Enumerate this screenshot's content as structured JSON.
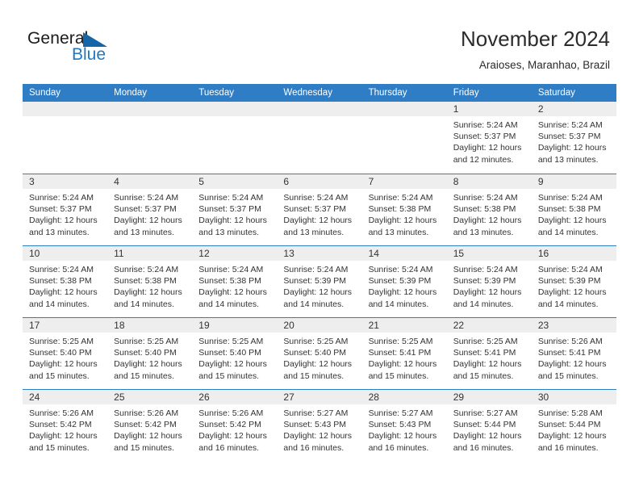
{
  "brand": {
    "name_top": "General",
    "name_bottom": "Blue",
    "triangle_icon": "triangle-icon",
    "color_dark": "#1b1b1b",
    "color_blue": "#1f78c1"
  },
  "header": {
    "title": "November 2024",
    "subtitle": "Araioses, Maranhao, Brazil"
  },
  "theme": {
    "header_blue": "#2f7dc4",
    "day_band_gray": "#eeeeee",
    "text": "#333333"
  },
  "calendar": {
    "weekdays": [
      "Sunday",
      "Monday",
      "Tuesday",
      "Wednesday",
      "Thursday",
      "Friday",
      "Saturday"
    ],
    "weeks": [
      [
        {
          "day": "",
          "lines": []
        },
        {
          "day": "",
          "lines": []
        },
        {
          "day": "",
          "lines": []
        },
        {
          "day": "",
          "lines": []
        },
        {
          "day": "",
          "lines": []
        },
        {
          "day": "1",
          "lines": [
            "Sunrise: 5:24 AM",
            "Sunset: 5:37 PM",
            "Daylight: 12 hours",
            "and 12 minutes."
          ]
        },
        {
          "day": "2",
          "lines": [
            "Sunrise: 5:24 AM",
            "Sunset: 5:37 PM",
            "Daylight: 12 hours",
            "and 13 minutes."
          ]
        }
      ],
      [
        {
          "day": "3",
          "lines": [
            "Sunrise: 5:24 AM",
            "Sunset: 5:37 PM",
            "Daylight: 12 hours",
            "and 13 minutes."
          ]
        },
        {
          "day": "4",
          "lines": [
            "Sunrise: 5:24 AM",
            "Sunset: 5:37 PM",
            "Daylight: 12 hours",
            "and 13 minutes."
          ]
        },
        {
          "day": "5",
          "lines": [
            "Sunrise: 5:24 AM",
            "Sunset: 5:37 PM",
            "Daylight: 12 hours",
            "and 13 minutes."
          ]
        },
        {
          "day": "6",
          "lines": [
            "Sunrise: 5:24 AM",
            "Sunset: 5:37 PM",
            "Daylight: 12 hours",
            "and 13 minutes."
          ]
        },
        {
          "day": "7",
          "lines": [
            "Sunrise: 5:24 AM",
            "Sunset: 5:38 PM",
            "Daylight: 12 hours",
            "and 13 minutes."
          ]
        },
        {
          "day": "8",
          "lines": [
            "Sunrise: 5:24 AM",
            "Sunset: 5:38 PM",
            "Daylight: 12 hours",
            "and 13 minutes."
          ]
        },
        {
          "day": "9",
          "lines": [
            "Sunrise: 5:24 AM",
            "Sunset: 5:38 PM",
            "Daylight: 12 hours",
            "and 14 minutes."
          ]
        }
      ],
      [
        {
          "day": "10",
          "lines": [
            "Sunrise: 5:24 AM",
            "Sunset: 5:38 PM",
            "Daylight: 12 hours",
            "and 14 minutes."
          ]
        },
        {
          "day": "11",
          "lines": [
            "Sunrise: 5:24 AM",
            "Sunset: 5:38 PM",
            "Daylight: 12 hours",
            "and 14 minutes."
          ]
        },
        {
          "day": "12",
          "lines": [
            "Sunrise: 5:24 AM",
            "Sunset: 5:38 PM",
            "Daylight: 12 hours",
            "and 14 minutes."
          ]
        },
        {
          "day": "13",
          "lines": [
            "Sunrise: 5:24 AM",
            "Sunset: 5:39 PM",
            "Daylight: 12 hours",
            "and 14 minutes."
          ]
        },
        {
          "day": "14",
          "lines": [
            "Sunrise: 5:24 AM",
            "Sunset: 5:39 PM",
            "Daylight: 12 hours",
            "and 14 minutes."
          ]
        },
        {
          "day": "15",
          "lines": [
            "Sunrise: 5:24 AM",
            "Sunset: 5:39 PM",
            "Daylight: 12 hours",
            "and 14 minutes."
          ]
        },
        {
          "day": "16",
          "lines": [
            "Sunrise: 5:24 AM",
            "Sunset: 5:39 PM",
            "Daylight: 12 hours",
            "and 14 minutes."
          ]
        }
      ],
      [
        {
          "day": "17",
          "lines": [
            "Sunrise: 5:25 AM",
            "Sunset: 5:40 PM",
            "Daylight: 12 hours",
            "and 15 minutes."
          ]
        },
        {
          "day": "18",
          "lines": [
            "Sunrise: 5:25 AM",
            "Sunset: 5:40 PM",
            "Daylight: 12 hours",
            "and 15 minutes."
          ]
        },
        {
          "day": "19",
          "lines": [
            "Sunrise: 5:25 AM",
            "Sunset: 5:40 PM",
            "Daylight: 12 hours",
            "and 15 minutes."
          ]
        },
        {
          "day": "20",
          "lines": [
            "Sunrise: 5:25 AM",
            "Sunset: 5:40 PM",
            "Daylight: 12 hours",
            "and 15 minutes."
          ]
        },
        {
          "day": "21",
          "lines": [
            "Sunrise: 5:25 AM",
            "Sunset: 5:41 PM",
            "Daylight: 12 hours",
            "and 15 minutes."
          ]
        },
        {
          "day": "22",
          "lines": [
            "Sunrise: 5:25 AM",
            "Sunset: 5:41 PM",
            "Daylight: 12 hours",
            "and 15 minutes."
          ]
        },
        {
          "day": "23",
          "lines": [
            "Sunrise: 5:26 AM",
            "Sunset: 5:41 PM",
            "Daylight: 12 hours",
            "and 15 minutes."
          ]
        }
      ],
      [
        {
          "day": "24",
          "lines": [
            "Sunrise: 5:26 AM",
            "Sunset: 5:42 PM",
            "Daylight: 12 hours",
            "and 15 minutes."
          ]
        },
        {
          "day": "25",
          "lines": [
            "Sunrise: 5:26 AM",
            "Sunset: 5:42 PM",
            "Daylight: 12 hours",
            "and 15 minutes."
          ]
        },
        {
          "day": "26",
          "lines": [
            "Sunrise: 5:26 AM",
            "Sunset: 5:42 PM",
            "Daylight: 12 hours",
            "and 16 minutes."
          ]
        },
        {
          "day": "27",
          "lines": [
            "Sunrise: 5:27 AM",
            "Sunset: 5:43 PM",
            "Daylight: 12 hours",
            "and 16 minutes."
          ]
        },
        {
          "day": "28",
          "lines": [
            "Sunrise: 5:27 AM",
            "Sunset: 5:43 PM",
            "Daylight: 12 hours",
            "and 16 minutes."
          ]
        },
        {
          "day": "29",
          "lines": [
            "Sunrise: 5:27 AM",
            "Sunset: 5:44 PM",
            "Daylight: 12 hours",
            "and 16 minutes."
          ]
        },
        {
          "day": "30",
          "lines": [
            "Sunrise: 5:28 AM",
            "Sunset: 5:44 PM",
            "Daylight: 12 hours",
            "and 16 minutes."
          ]
        }
      ]
    ]
  }
}
